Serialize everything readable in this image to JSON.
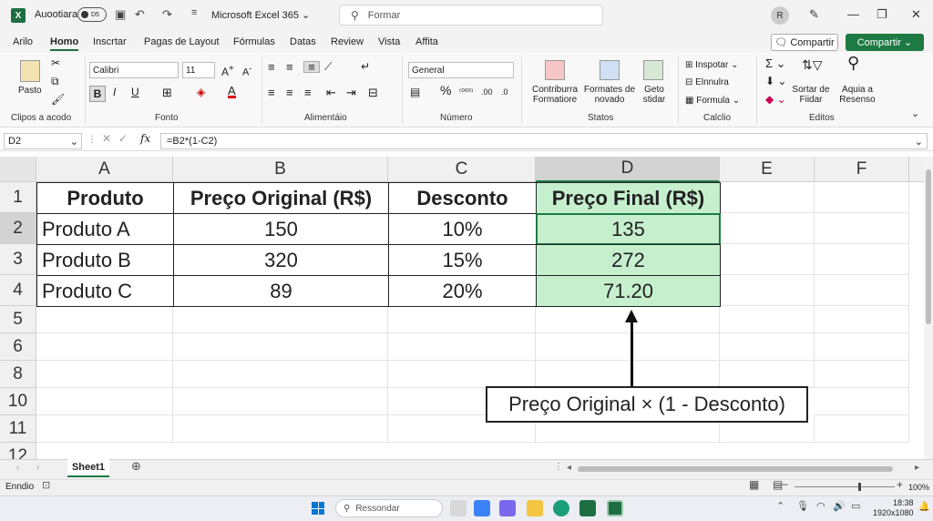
{
  "titlebar": {
    "autosave_label": "Auootiara",
    "toggle_label": "D5",
    "app_title": "Microsoft Excel 365",
    "search_placeholder": "Formar",
    "avatar": "R"
  },
  "menu": [
    "Arilo",
    "Homo",
    "Inscrtar",
    "Pagas de Layout",
    "Fórmulas",
    "Datas",
    "Review",
    "Vista",
    "Affita"
  ],
  "share": {
    "secondary": "Compartir",
    "primary": "Compartir"
  },
  "ribbon": {
    "clipboard": {
      "paste": "Pasto",
      "group": "Clipos a acodo"
    },
    "font": {
      "name": "Calibri",
      "size": "11",
      "group": "Fonto"
    },
    "alignment": {
      "group": "Alimentáio"
    },
    "number": {
      "format": "General",
      "group": "Número"
    },
    "styles": {
      "cond": "Contriburra\nFormatiore",
      "table": "Formates de\nnovado",
      "cell": "Geto\nstidar",
      "group": "Statos"
    },
    "cells": {
      "insert": "Inspotar",
      "delete": "Elnnulra",
      "format": "Formula",
      "group": "Calclio"
    },
    "editing": {
      "sort": "Sortar de\nFiidar",
      "find": "Aquia a\nResenso",
      "group": "Editos"
    }
  },
  "formula_bar": {
    "name_box": "D2",
    "formula": "=B2*(1-C2)",
    "fx": "fx"
  },
  "columns": [
    "A",
    "B",
    "C",
    "D",
    "E",
    "F"
  ],
  "rows": [
    "1",
    "2",
    "3",
    "4",
    "5",
    "6",
    "8",
    "10",
    "11",
    "12"
  ],
  "table": {
    "headers": [
      "Produto",
      "Preço Original (R$)",
      "Desconto",
      "Preço Final (R$)"
    ],
    "rows": [
      [
        "Produto A",
        "150",
        "10%",
        "135"
      ],
      [
        "Produto B",
        "320",
        "15%",
        "272"
      ],
      [
        "Produto C",
        "89",
        "20%",
        "71.20"
      ]
    ]
  },
  "callout": "Preço Original × (1 - Desconto)",
  "sheet_tab": "Sheet1",
  "status": {
    "left": "Enndio",
    "zoom": "100%"
  },
  "taskbar": {
    "search": "Ressondar",
    "time": "18:38",
    "resolution": "1920x1080"
  }
}
